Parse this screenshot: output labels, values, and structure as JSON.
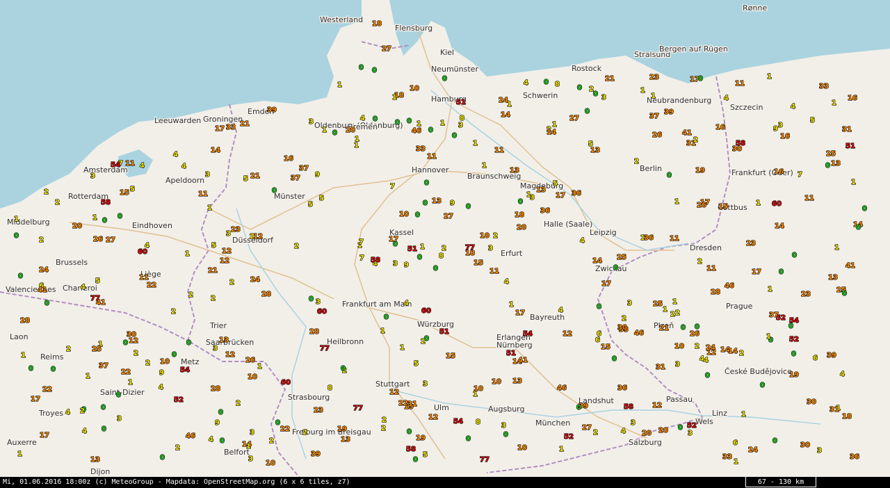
{
  "status": {
    "caption": "Mi, 01.06.2016 18:00z (c) MeteoGroup - Mapdata: OpenStreetMap.org (6 x 6 tiles, z7)",
    "scale": "67 - 130 km"
  },
  "colors": {
    "land": "#f2efe9",
    "sea": "#aad3df",
    "border": "#b08fc0",
    "road": "#e0c090",
    "low": "#22cc22",
    "mid": "#f2e600",
    "high": "#ff8c00",
    "extreme": "#e01010"
  },
  "cities": [
    "Westerland",
    "Flensburg",
    "Kiel",
    "Neumünster",
    "Rostock",
    "Stralsund",
    "Bergen auf Rügen",
    "Rønne",
    "Hamburg",
    "Schwerin",
    "Neubrandenburg",
    "Szczecin",
    "Emden",
    "Leeuwarden",
    "Groningen",
    "Oldenburg (Oldenburg)",
    "Bremen",
    "Amsterdam",
    "Apeldoorn",
    "Rotterdam",
    "Hannover",
    "Braunschweig",
    "Magdeburg",
    "Berlin",
    "Frankfurt (Oder)",
    "Münster",
    "Eindhoven",
    "Middelburg",
    "Düsseldorf",
    "Kassel",
    "Halle (Saale)",
    "Leipzig",
    "Cottbus",
    "Brussels",
    "Liège",
    "Charleroi",
    "Valenciennes",
    "Erfurt",
    "Dresden",
    "Zwickau",
    "Frankfurt am Main",
    "Prague",
    "Plzeň",
    "Würzburg",
    "Bayreuth",
    "Laon",
    "Reims",
    "Metz",
    "Trier",
    "Saarbrücken",
    "Heilbronn",
    "Erlangen",
    "Nürnberg",
    "Stuttgart",
    "Saint-Dizier",
    "Strasbourg",
    "Ulm",
    "Augsburg",
    "München",
    "Landshut",
    "Passau",
    "Linz",
    "České Budějovice",
    "Troyes",
    "Freiburg im Breisgau",
    "Salzburg",
    "Auxerre",
    "Belfort",
    "Dijon",
    "Wels"
  ],
  "observations": [
    "0",
    "0",
    "0",
    "0",
    "1",
    "1",
    "2",
    "2",
    "3",
    "0",
    "1",
    "4",
    "5",
    "0",
    "0",
    "1",
    "2",
    "9",
    "4",
    "0",
    "1",
    "3",
    "1",
    "2",
    "0",
    "13",
    "17",
    "12",
    "10",
    "21",
    "23",
    "26",
    "24",
    "30",
    "25",
    "37",
    "11",
    "15",
    "14",
    "18",
    "13",
    "19",
    "20",
    "22",
    "16",
    "33",
    "39",
    "28",
    "10",
    "11",
    "12",
    "14",
    "17",
    "0",
    "0",
    "1",
    "1",
    "2",
    "3",
    "5",
    "2",
    "4",
    "6",
    "7",
    "8",
    "0",
    "3",
    "4",
    "54",
    "58",
    "60",
    "51",
    "52",
    "77",
    "46",
    "41",
    "36",
    "31",
    "27"
  ]
}
